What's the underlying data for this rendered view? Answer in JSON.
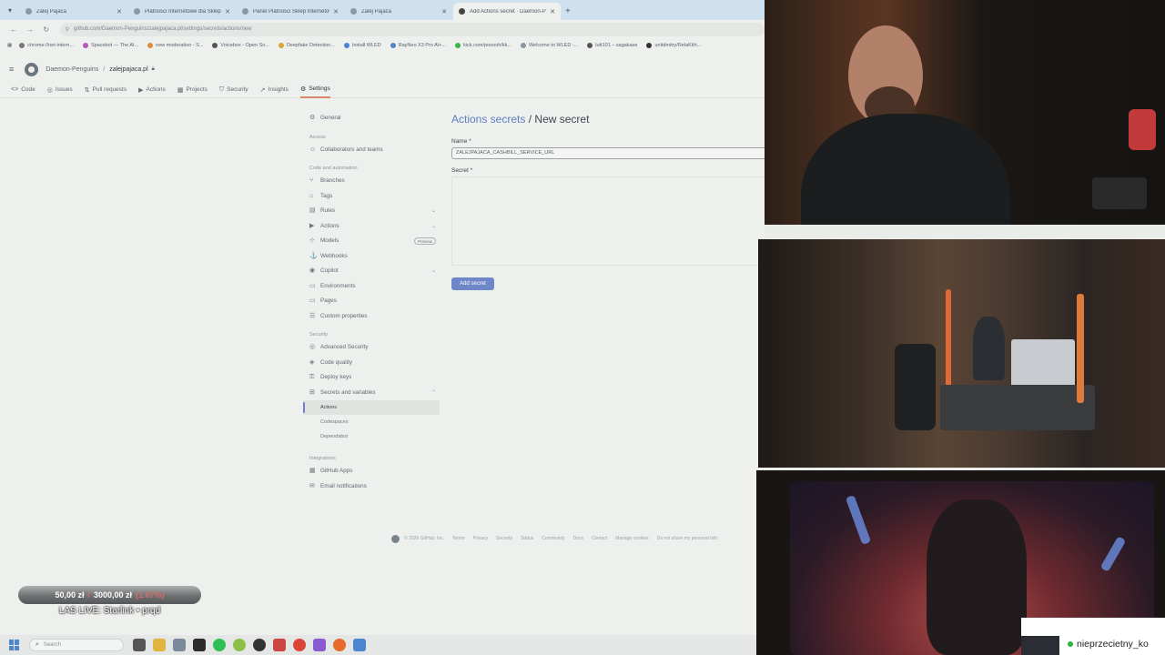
{
  "browser": {
    "tabs": [
      {
        "title": "Zalej Pajaca",
        "active": false
      },
      {
        "title": "Platności Internetowe dla Sklep",
        "active": false
      },
      {
        "title": "Panel Platności Sklep Internetowy",
        "active": false
      },
      {
        "title": "Zalej Pajaca",
        "active": false
      },
      {
        "title": "Add Actions secret · Daemon-P",
        "active": true
      }
    ],
    "new_tab": "+",
    "url": "github.com/Daemon-Penguins/zalejpajaca.pl/settings/secrets/actions/new",
    "bookmarks": [
      "chrome://net-intern...",
      "Spacebot — The AI...",
      "new moderation - S...",
      "Voicebox - Open So...",
      "Deepfake Detection...",
      "Install WLED",
      "RayNeo X3 Pro AI+...",
      "kick.com/pooooh/kk...",
      "Welcome to WLED -...",
      "lutt101 – sagakase",
      "unitdmitry/RelaKith..."
    ]
  },
  "github": {
    "owner": "Daemon-Penguins",
    "separator": "/",
    "repo": "zalejpajaca.pl",
    "nav": [
      {
        "label": "Code",
        "icon": "<>",
        "selected": false
      },
      {
        "label": "Issues",
        "icon": "◎",
        "selected": false
      },
      {
        "label": "Pull requests",
        "icon": "⇅",
        "selected": false
      },
      {
        "label": "Actions",
        "icon": "▶",
        "selected": false
      },
      {
        "label": "Projects",
        "icon": "▦",
        "selected": false
      },
      {
        "label": "Security",
        "icon": "⛉",
        "selected": false
      },
      {
        "label": "Insights",
        "icon": "↗",
        "selected": false
      },
      {
        "label": "Settings",
        "icon": "⚙",
        "selected": true
      }
    ],
    "sidebar": {
      "general": "General",
      "group_access": "Access",
      "collaborators": "Collaborators and teams",
      "group_code": "Code and automation",
      "branches": "Branches",
      "tags": "Tags",
      "rules": "Rules",
      "actions": "Actions",
      "models": "Models",
      "models_badge": "Preview",
      "webhooks": "Webhooks",
      "copilot": "Copilot",
      "environments": "Environments",
      "pages": "Pages",
      "custom_properties": "Custom properties",
      "group_security": "Security",
      "advanced_security": "Advanced Security",
      "code_quality": "Code quality",
      "deploy_keys": "Deploy keys",
      "secrets_variables": "Secrets and variables",
      "sub_actions": "Actions",
      "sub_codespaces": "Codespaces",
      "sub_dependabot": "Dependabot",
      "group_integrations": "Integrations",
      "github_apps": "GitHub Apps",
      "email_notifications": "Email notifications"
    },
    "main": {
      "crumb_link": "Actions secrets",
      "crumb_sep": "/",
      "crumb_current": "New secret",
      "name_label": "Name *",
      "name_value": "ZALEJPAJACA_CASHBILL_SERVICE_URL",
      "secret_label": "Secret *",
      "secret_value": "",
      "add_button": "Add secret"
    },
    "footer": [
      "© 2026 GitHub, Inc.",
      "Terms",
      "Privacy",
      "Security",
      "Status",
      "Community",
      "Docs",
      "Contact",
      "Manage cookies",
      "Do not share my personal info"
    ]
  },
  "overlay": {
    "donation_current": "50,00 zł",
    "donation_slash": "/",
    "donation_goal": "3000,00 zł",
    "donation_pct": "(1.67%)",
    "donation_fraction": 0.0167,
    "live_text": "LAS LIVE: Starlink • prqd"
  },
  "taskbar": {
    "search_placeholder": "Search"
  },
  "chat": {
    "username": "nieprzecietny_ko"
  },
  "colors": {
    "accent_link": "#5a7fc0",
    "button_primary": "#6d87c9",
    "tab_bar": "#cfe0ee",
    "selected_underline": "#d9886b"
  }
}
